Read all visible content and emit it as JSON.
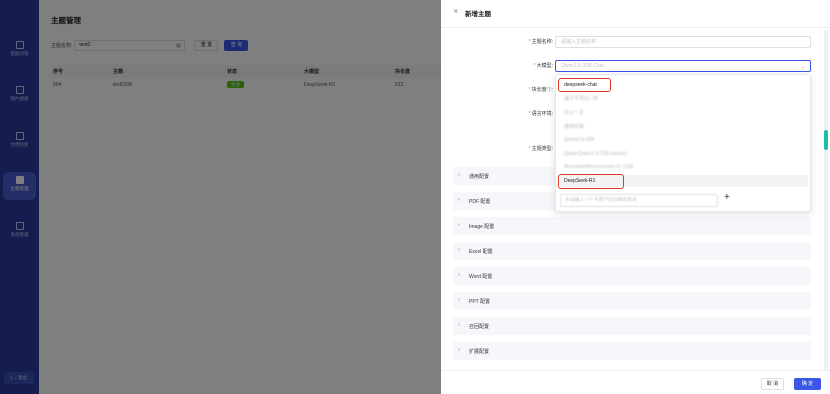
{
  "sidebar": {
    "items": [
      {
        "label": "智能问答",
        "active": false
      },
      {
        "label": "图片搜索",
        "active": false
      },
      {
        "label": "文档检索",
        "active": false
      },
      {
        "label": "主题管理",
        "active": true
      },
      {
        "label": "系统管理",
        "active": false
      }
    ],
    "logout_label": "[→ 退出"
  },
  "main": {
    "title": "主题管理",
    "filter_label": "主题名称:",
    "filter_value": "test0",
    "reset_label": "重 置",
    "query_label": "查 询",
    "table": {
      "columns": [
        "序号",
        "主题",
        "状态",
        "大模型",
        "块长度"
      ],
      "rows": [
        {
          "index": "594",
          "topic": "test0206",
          "status": "生效",
          "model": "DeepSeek-R1",
          "chunk": "512"
        }
      ]
    }
  },
  "drawer": {
    "title": "新增主题",
    "fields": {
      "name_label": "主题名称:",
      "name_placeholder": "请输入主题名称",
      "model_label": "大模型:",
      "model_placeholder": "Qwen1.5-32B-Chat",
      "chunk_label": "块长度①:",
      "lang_label": "语言环境:",
      "type_label": "主题类型:"
    },
    "dropdown": {
      "options": [
        {
          "label": "deepseek-chat",
          "blurred": false,
          "highlight": true
        },
        {
          "label": "通义千问VL-7B",
          "blurred": true
        },
        {
          "label": "文心一言",
          "blurred": true
        },
        {
          "label": "通用问答",
          "blurred": true
        },
        {
          "label": "Qwen2.5-32B",
          "blurred": true
        },
        {
          "label": "Qwen/Qwen2.5-32B-Instruct",
          "blurred": true
        },
        {
          "label": "MoonshotAI/moonshot-v1-128k",
          "blurred": true
        },
        {
          "label": "DeepSeek-R1",
          "blurred": false,
          "highlight": true
        }
      ],
      "custom_placeholder": "手动输入一个不再下拉列表的答案",
      "plus": "+"
    },
    "sections": [
      "通用配置",
      "PDF 配置",
      "Image 配置",
      "Excel 配置",
      "Word 配置",
      "PPT 配置",
      "召回配置",
      "扩展配置"
    ],
    "cancel_label": "取 消",
    "ok_label": "确 定"
  },
  "colors": {
    "sidebar_bg": "#2a3a9c",
    "accent": "#3a57e8",
    "status_green": "#52c41a",
    "highlight_red": "#d93a2a"
  }
}
